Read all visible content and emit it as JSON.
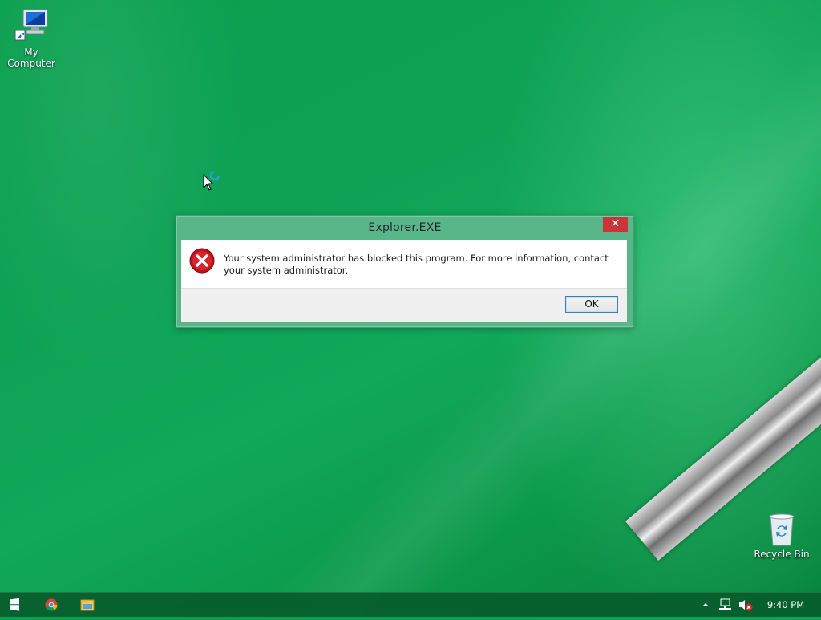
{
  "desktop": {
    "icons": [
      {
        "label": "My Computer",
        "icon": "computer-icon"
      },
      {
        "label": "Recycle Bin",
        "icon": "recycle-bin-icon"
      }
    ]
  },
  "dialog": {
    "title": "Explorer.EXE",
    "close_label": "✕",
    "icon": "error-icon",
    "message": "Your system administrator has blocked this program. For more information, contact your system administrator.",
    "ok_label": "OK"
  },
  "taskbar": {
    "start_icon": "windows-start-icon",
    "pinned": [
      "chrome-icon",
      "file-explorer-icon"
    ],
    "tray": [
      "show-hidden-icons-icon",
      "network-icon",
      "volume-muted-icon"
    ],
    "clock": "9:40 PM"
  },
  "colors": {
    "desktop_green": "#0ea255",
    "dialog_frame": "#58b688",
    "close_red": "#c8363a",
    "taskbar": "#065c2c"
  }
}
